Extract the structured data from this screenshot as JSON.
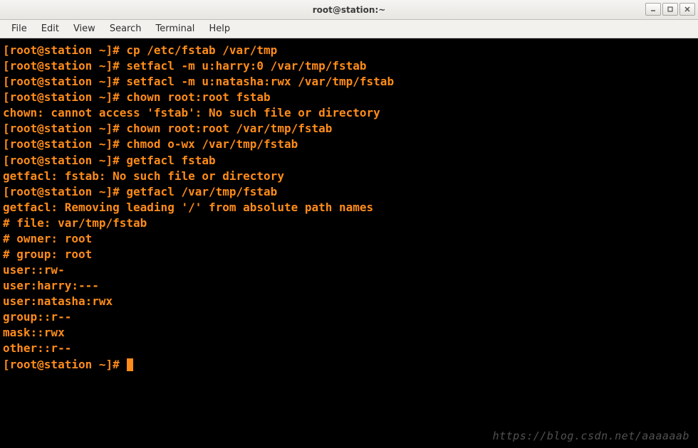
{
  "window": {
    "title": "root@station:~"
  },
  "menu": {
    "file": "File",
    "edit": "Edit",
    "view": "View",
    "search": "Search",
    "terminal": "Terminal",
    "help": "Help"
  },
  "terminal": {
    "lines": [
      "[root@station ~]# cp /etc/fstab /var/tmp",
      "[root@station ~]# setfacl -m u:harry:0 /var/tmp/fstab",
      "[root@station ~]# setfacl -m u:natasha:rwx /var/tmp/fstab",
      "[root@station ~]# chown root:root fstab",
      "chown: cannot access 'fstab': No such file or directory",
      "[root@station ~]# chown root:root /var/tmp/fstab",
      "[root@station ~]# chmod o-wx /var/tmp/fstab",
      "[root@station ~]# getfacl fstab",
      "getfacl: fstab: No such file or directory",
      "[root@station ~]# getfacl /var/tmp/fstab",
      "getfacl: Removing leading '/' from absolute path names",
      "# file: var/tmp/fstab",
      "# owner: root",
      "# group: root",
      "user::rw-",
      "user:harry:---",
      "user:natasha:rwx",
      "group::r--",
      "mask::rwx",
      "other::r--",
      "",
      "[root@station ~]# "
    ],
    "watermark": "https://blog.csdn.net/aaaaaab"
  }
}
